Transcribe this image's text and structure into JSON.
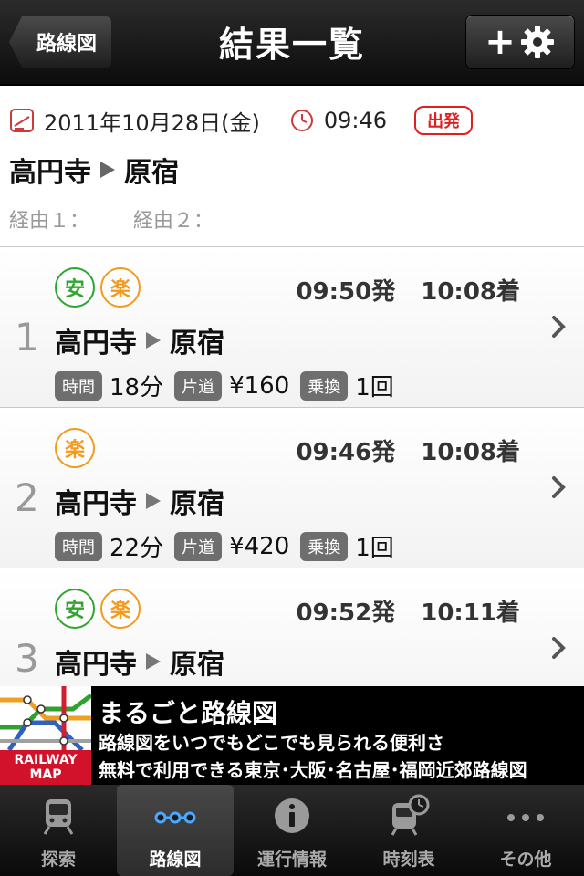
{
  "nav": {
    "back_label": "路線図",
    "title": "結果一覧"
  },
  "search": {
    "date": "2011年10月28日(金)",
    "time": "09:46",
    "mode_badge": "出発",
    "from": "高円寺",
    "to": "原宿",
    "via1": "経由１：",
    "via2": "経由２："
  },
  "results": [
    {
      "index": "1",
      "badges": [
        {
          "label": "安",
          "color": "#2fa52f"
        },
        {
          "label": "楽",
          "color": "#f39a1d"
        }
      ],
      "depart": "09:50発",
      "arrive": "10:08着",
      "from": "高円寺",
      "to": "原宿",
      "time_label": "時間",
      "time": "18分",
      "fare_label": "片道",
      "fare": "¥160",
      "transfer_label": "乗換",
      "transfers": "1回"
    },
    {
      "index": "2",
      "badges": [
        {
          "label": "楽",
          "color": "#f39a1d"
        }
      ],
      "depart": "09:46発",
      "arrive": "10:08着",
      "from": "高円寺",
      "to": "原宿",
      "time_label": "時間",
      "time": "22分",
      "fare_label": "片道",
      "fare": "¥420",
      "transfer_label": "乗換",
      "transfers": "1回"
    },
    {
      "index": "3",
      "badges": [
        {
          "label": "安",
          "color": "#2fa52f"
        },
        {
          "label": "楽",
          "color": "#f39a1d"
        }
      ],
      "depart": "09:52発",
      "arrive": "10:11着",
      "from": "高円寺",
      "to": "原宿"
    }
  ],
  "ad": {
    "logo_line1": "RAILWAY",
    "logo_line2": "MAP",
    "title": "まるごと路線図",
    "line1": "路線図をいつでもどこでも見られる便利さ",
    "line2": "無料で利用できる東京･大阪･名古屋･福岡近郊路線図"
  },
  "tabs": [
    {
      "label": "探索",
      "icon": "train-icon"
    },
    {
      "label": "路線図",
      "icon": "route-map-icon",
      "active": true
    },
    {
      "label": "運行情報",
      "icon": "info-icon"
    },
    {
      "label": "時刻表",
      "icon": "timetable-icon"
    },
    {
      "label": "その他",
      "icon": "more-icon"
    }
  ],
  "colors": {
    "accent_red": "#e02020",
    "green": "#2fa52f",
    "orange": "#f39a1d",
    "ad_red": "#d2112a"
  }
}
